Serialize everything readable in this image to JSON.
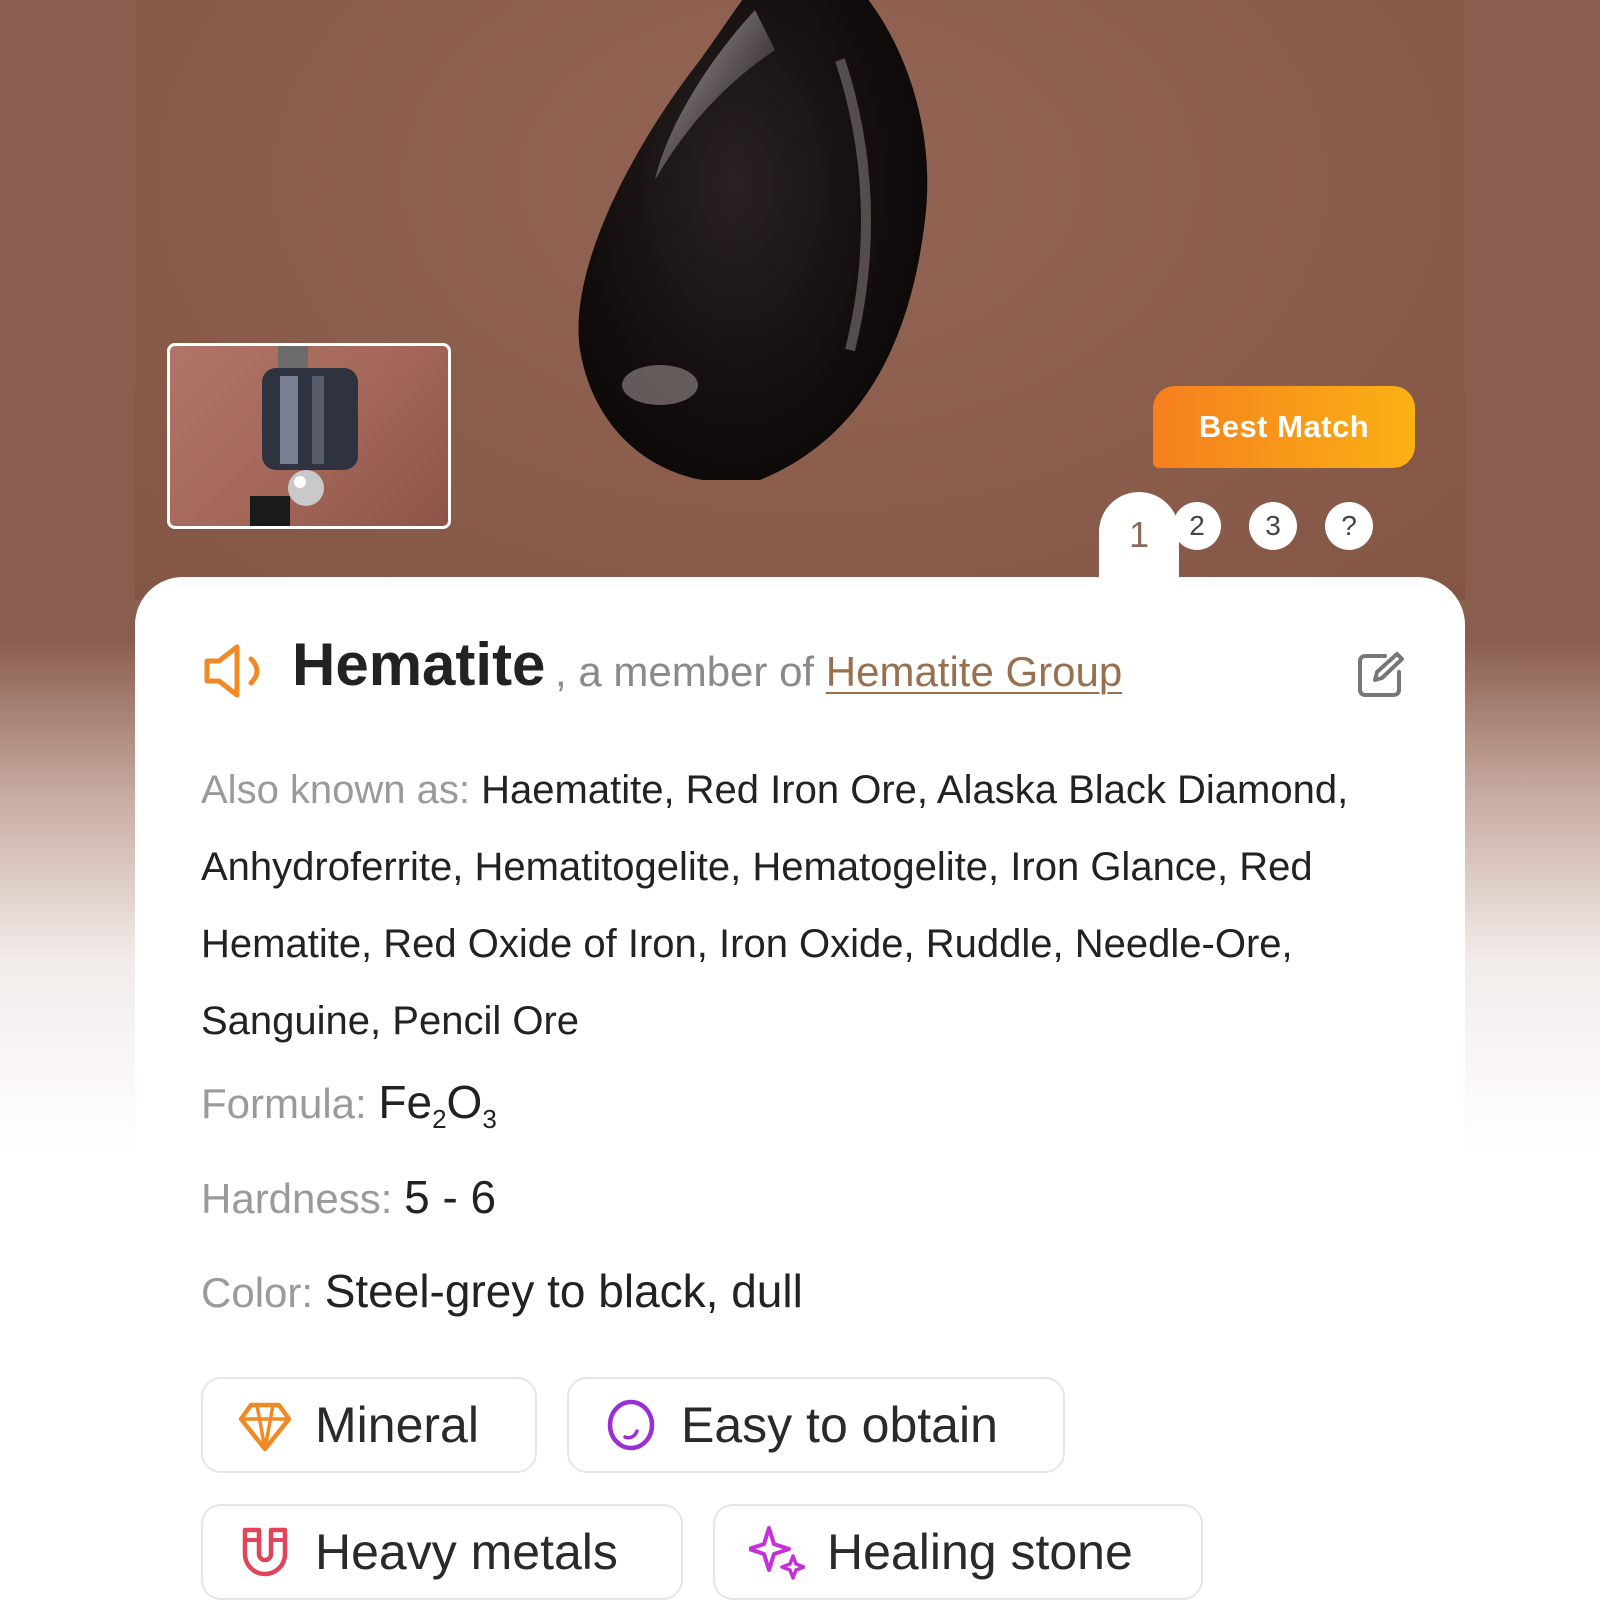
{
  "badge": {
    "label": "Best Match"
  },
  "pager": {
    "pages": [
      "1",
      "2",
      "3",
      "?"
    ],
    "active": "1"
  },
  "result": {
    "name": "Hematite",
    "member_prefix": ", a member of ",
    "group": "Hematite Group"
  },
  "details": {
    "aka_label": "Also known as: ",
    "aka_value": "Haematite, Red Iron Ore, Alaska Black Diamond, Anhydroferrite, Hematitogelite, Hematogelite, Iron Glance, Red Hematite, Red Oxide of Iron, Iron Oxide, Ruddle, Needle-Ore, Sanguine, Pencil Ore",
    "formula_label": "Formula: ",
    "formula_el1": "Fe",
    "formula_sub1": "2",
    "formula_el2": "O",
    "formula_sub2": "3",
    "hardness_label": "Hardness: ",
    "hardness_value": "5 - 6",
    "color_label": "Color: ",
    "color_value": "Steel-grey to black, dull"
  },
  "tags": [
    {
      "label": "Mineral",
      "icon": "crystal-icon",
      "color": "#f08a24"
    },
    {
      "label": "Easy to obtain",
      "icon": "stone-icon",
      "color": "#9b2fd6"
    },
    {
      "label": "Heavy metals",
      "icon": "magnet-icon",
      "color": "#e0445a"
    },
    {
      "label": "Healing stone",
      "icon": "sparkle-icon",
      "color": "#c630d8"
    }
  ],
  "colors": {
    "accent": "#f08a24",
    "link": "#98704f",
    "background": "#8d5f4f"
  }
}
